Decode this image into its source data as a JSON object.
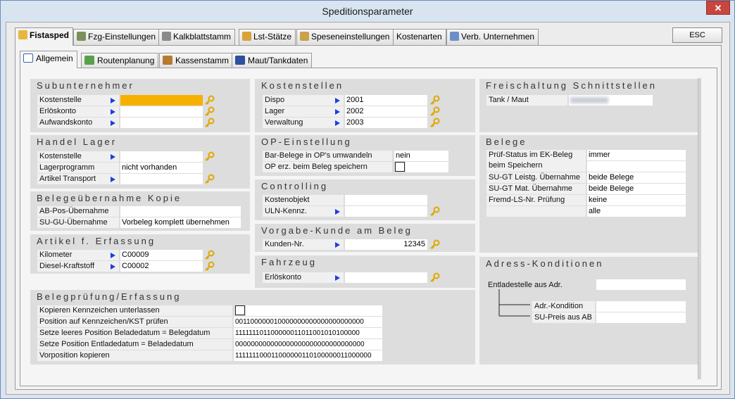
{
  "window": {
    "title": "Speditionsparameter",
    "close_label": "✕"
  },
  "tabs": [
    {
      "label": "Fistasped",
      "icon": "folder-icon",
      "active": true
    },
    {
      "label": "Fzg-Einstellungen",
      "icon": "truck-icon"
    },
    {
      "label": "Kalkblattstamm",
      "icon": "calculator-icon"
    },
    {
      "label": "Lst-Stätze",
      "icon": "money-icon"
    },
    {
      "label": "Speseneinstellungen",
      "icon": "coins-icon"
    },
    {
      "label": "Kostenarten",
      "icon": ""
    },
    {
      "label": "Verb. Unternehmen",
      "icon": "house-icon"
    }
  ],
  "esc_label": "ESC",
  "subtabs": [
    {
      "label": "Allgemein",
      "icon": "window-icon",
      "active": true
    },
    {
      "label": "Routenplanung",
      "icon": "map-icon"
    },
    {
      "label": "Kassenstamm",
      "icon": "cashbox-icon"
    },
    {
      "label": "Maut/Tankdaten",
      "icon": "road-icon"
    }
  ],
  "subunternehmer": {
    "title": "Subunternehmer",
    "rows": [
      {
        "label": "Kostenstelle",
        "value": ""
      },
      {
        "label": "Erlöskonto",
        "value": ""
      },
      {
        "label": "Aufwandskonto",
        "value": ""
      }
    ]
  },
  "handel_lager": {
    "title": "Handel Lager",
    "rows": [
      {
        "label": "Kostenstelle",
        "value": ""
      },
      {
        "label": "Lagerprogramm",
        "value": "nicht vorhanden"
      },
      {
        "label": "Artikel Transport",
        "value": ""
      }
    ]
  },
  "belegeuebernahme": {
    "title": "Belegeübernahme Kopie",
    "rows": [
      {
        "label": "AB-Pos-Übernahme",
        "value": ""
      },
      {
        "label": "SU-GU-Übernahme",
        "value": "Vorbeleg komplett übernehmen"
      }
    ]
  },
  "artikel": {
    "title": "Artikel f. Erfassung",
    "rows": [
      {
        "label": "Kilometer",
        "value": "C00009"
      },
      {
        "label": "Diesel-Kraftstoff",
        "value": "C00002"
      }
    ]
  },
  "belegpruefung": {
    "title": "Belegprüfung/Erfassung",
    "rows": [
      {
        "label": "Kopieren Kennzeichen unterlassen",
        "value": ""
      },
      {
        "label": "Position auf Kennzeichen/KST prüfen",
        "value": "001100000010000000000000000000000"
      },
      {
        "label": "Setze leeres Position Beladedatum = Belegdatum",
        "value": "111111101100000011011001010100000"
      },
      {
        "label": "Setze Position Entladedatum = Beladedatum",
        "value": "000000000000000000000000000000000"
      },
      {
        "label": "Vorposition kopieren",
        "value": "111111100011000000110100000011000000"
      }
    ]
  },
  "kostenstellen": {
    "title": "Kostenstellen",
    "rows": [
      {
        "label": "Dispo",
        "value": "2001"
      },
      {
        "label": "Lager",
        "value": "2002"
      },
      {
        "label": "Verwaltung",
        "value": "2003"
      }
    ]
  },
  "op_einstellung": {
    "title": "OP-Einstellung",
    "rows": [
      {
        "label": "Bar-Belege in OP's umwandeln",
        "value": "nein"
      },
      {
        "label": "OP erz. beim Beleg speichern",
        "value": ""
      }
    ]
  },
  "controlling": {
    "title": "Controlling",
    "rows": [
      {
        "label": "Kostenobjekt",
        "value": ""
      },
      {
        "label": "ULN-Kennz.",
        "value": ""
      }
    ]
  },
  "vorgabe_kunde": {
    "title": "Vorgabe-Kunde am Beleg",
    "rows": [
      {
        "label": "Kunden-Nr.",
        "value": "12345"
      }
    ]
  },
  "fahrzeug": {
    "title": "Fahrzeug",
    "rows": [
      {
        "label": "Erlöskonto",
        "value": ""
      }
    ]
  },
  "freischaltung": {
    "title": "Freischaltung Schnittstellen",
    "rows": [
      {
        "label": "Tank / Maut",
        "value": ""
      }
    ]
  },
  "belege": {
    "title": "Belege",
    "rows": [
      {
        "label": "Prüf-Status im EK-Beleg beim Speichern",
        "value": "immer"
      },
      {
        "label": "SU-GT Leistg. Übernahme",
        "value": "beide Belege"
      },
      {
        "label": "SU-GT Mat. Übernahme",
        "value": "beide Belege"
      },
      {
        "label": "Fremd-LS-Nr. Prüfung",
        "value": "keine"
      },
      {
        "label": "",
        "value": "alle"
      }
    ]
  },
  "adress_konditionen": {
    "title": "Adress-Konditionen",
    "rows": [
      {
        "label": "Entladestelle aus Adr.",
        "value": ""
      },
      {
        "label": "Adr.-Kondition",
        "value": ""
      },
      {
        "label": "SU-Preis aus AB",
        "value": ""
      }
    ]
  }
}
